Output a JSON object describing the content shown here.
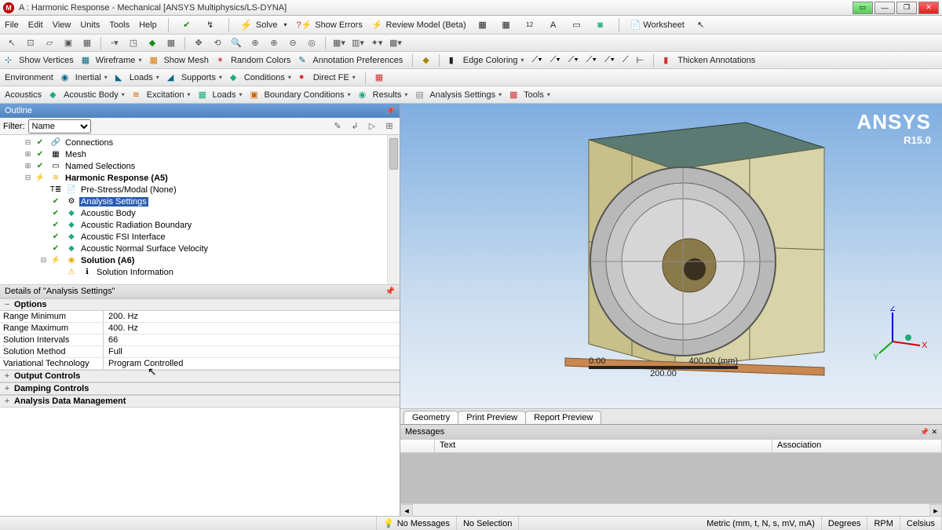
{
  "title": "A : Harmonic Response - Mechanical [ANSYS Multiphysics/LS-DYNA]",
  "menu": {
    "file": "File",
    "edit": "Edit",
    "view": "View",
    "units": "Units",
    "tools": "Tools",
    "help": "Help",
    "solve": "Solve",
    "show_errors": "Show Errors",
    "review_model": "Review Model (Beta)",
    "worksheet": "Worksheet"
  },
  "cmdbar2": {
    "show_vertices": "Show Vertices",
    "wireframe": "Wireframe",
    "show_mesh": "Show Mesh",
    "random": "Random Colors",
    "annotation_prefs": "Annotation Preferences",
    "edge_coloring": "Edge Coloring",
    "thicken": "Thicken Annotations"
  },
  "cmdbar3": {
    "environment": "Environment",
    "inertial": "Inertial",
    "loads": "Loads",
    "supports": "Supports",
    "conditions": "Conditions",
    "directfe": "Direct FE"
  },
  "cmdbar4": {
    "acoustics": "Acoustics",
    "acoustic_body": "Acoustic Body",
    "excitation": "Excitation",
    "loads": "Loads",
    "bc": "Boundary Conditions",
    "results": "Results",
    "analysis_settings": "Analysis Settings",
    "tools": "Tools"
  },
  "outline": {
    "title": "Outline",
    "filter_label": "Filter:",
    "filter_value": "Name",
    "nodes": {
      "connections": "Connections",
      "mesh": "Mesh",
      "named_selections": "Named Selections",
      "harmonic": "Harmonic Response (A5)",
      "prestress": "Pre-Stress/Modal (None)",
      "analysis_settings": "Analysis Settings",
      "acoustic_body": "Acoustic Body",
      "radiation_boundary": "Acoustic Radiation Boundary",
      "fsi": "Acoustic FSI Interface",
      "normal_velocity": "Acoustic Normal Surface Velocity",
      "solution": "Solution (A6)",
      "solution_info": "Solution Information"
    }
  },
  "details": {
    "title": "Details of \"Analysis Settings\"",
    "cats": {
      "options": "Options",
      "output": "Output Controls",
      "damping": "Damping Controls",
      "adm": "Analysis Data Management"
    },
    "rows": {
      "range_min": {
        "k": "Range Minimum",
        "v": "200. Hz"
      },
      "range_max": {
        "k": "Range Maximum",
        "v": "400. Hz"
      },
      "intervals": {
        "k": "Solution Intervals",
        "v": "66"
      },
      "method": {
        "k": "Solution Method",
        "v": "Full"
      },
      "vartech": {
        "k": "Variational Technology",
        "v": "Program Controlled"
      }
    }
  },
  "viewport": {
    "logo": "ANSYS",
    "release": "R15.0",
    "scale": {
      "left": "0.00",
      "mid": "200.00",
      "right": "400.00 (mm)"
    },
    "axes": {
      "x": "X",
      "y": "Y",
      "z": "Z"
    },
    "tabs": {
      "geometry": "Geometry",
      "print": "Print Preview",
      "report": "Report Preview"
    }
  },
  "messages": {
    "title": "Messages",
    "col_text": "Text",
    "col_assoc": "Association"
  },
  "status": {
    "no_messages": "No Messages",
    "no_selection": "No Selection",
    "units": "Metric (mm, t, N, s, mV, mA)",
    "degrees": "Degrees",
    "rpm": "RPM",
    "celsius": "Celsius"
  }
}
